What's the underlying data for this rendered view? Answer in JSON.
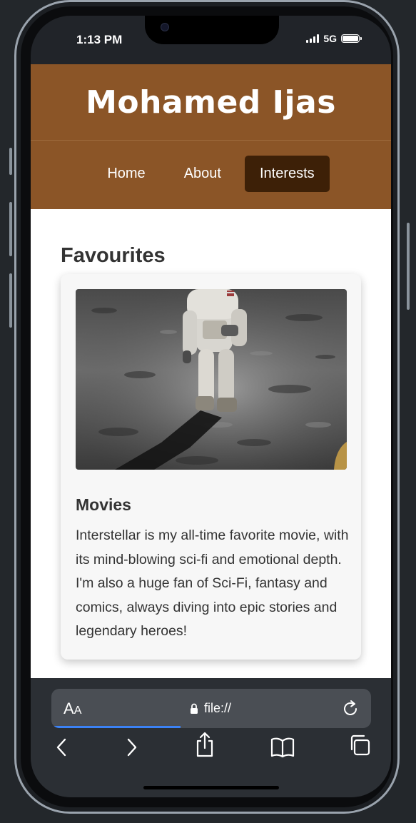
{
  "status_bar": {
    "time": "1:13 PM",
    "network": "5G"
  },
  "site": {
    "title": "Mohamed Ijas",
    "nav": [
      {
        "label": "Home",
        "active": false
      },
      {
        "label": "About",
        "active": false
      },
      {
        "label": "Interests",
        "active": true
      }
    ]
  },
  "main": {
    "section_title": "Favourites",
    "card": {
      "image_alt": "Astronaut on the lunar surface",
      "title": "Movies",
      "text": "Interstellar is my all-time favorite movie, with its mind-blowing sci-fi and emotional depth. I'm also a huge fan of Sci-Fi, fantasy and comics, always diving into epic stories and legendary heroes!"
    }
  },
  "browser": {
    "text_size_label": "AA",
    "url": "file://",
    "page_load_progress": 0.4
  },
  "colors": {
    "header_bg": "#8b5527",
    "nav_active_bg": "#3d2007",
    "progress": "#3b82f6"
  }
}
